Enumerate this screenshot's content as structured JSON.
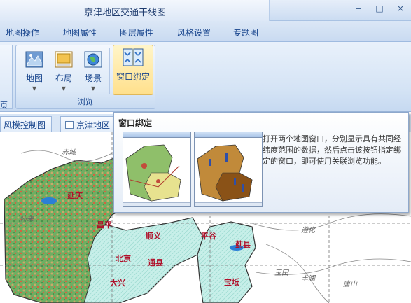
{
  "window": {
    "title": "京津地区交通干线图",
    "controls": {
      "minimize": "‒",
      "maximize": "□",
      "close": "×"
    }
  },
  "menu": {
    "items": [
      "地图操作",
      "地图属性",
      "图层属性",
      "风格设置",
      "专题图"
    ]
  },
  "ribbon": {
    "left_group_label": "页",
    "browse_group": {
      "label": "浏览",
      "buttons": [
        {
          "label": "地图",
          "icon": "map-icon"
        },
        {
          "label": "布局",
          "icon": "layout-icon"
        },
        {
          "label": "场景",
          "icon": "globe-scene-icon"
        }
      ],
      "active_button": {
        "label": "窗口绑定",
        "icon": "window-bind-icon"
      }
    }
  },
  "doc_tabs": [
    "风模控制图",
    "京津地区"
  ],
  "tooltip": {
    "title": "窗口绑定",
    "description": "打开两个地图窗口，分别显示具有共同经纬度范围的数据，然后点击该按钮指定绑定的窗口，即可使用关联浏览功能。"
  },
  "map": {
    "cities": [
      "延庆",
      "昌平",
      "顺义",
      "平谷",
      "蓟县",
      "北京",
      "通县",
      "大兴",
      "宝坻"
    ],
    "towns": [
      "赤城",
      "怀来",
      "遵化",
      "玉田",
      "丰润",
      "唐山"
    ]
  },
  "colors": {
    "accent": "#15428b",
    "ribbon_active": "#ffe08c",
    "city_label": "#b0102a"
  }
}
